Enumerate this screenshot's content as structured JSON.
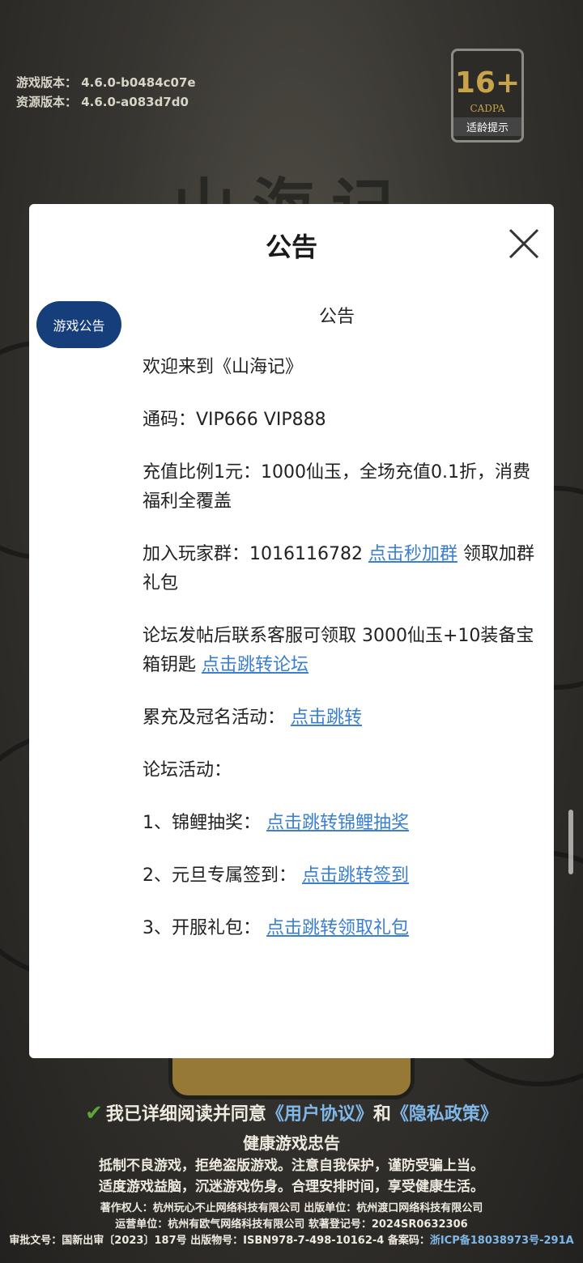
{
  "version": {
    "game": "游戏版本：  4.6.0-b0484c07e",
    "resource": "资源版本：  4.6.0-a083d7d0"
  },
  "age_badge": {
    "rating": "16+",
    "org": "CADPA",
    "tip": "适龄提示"
  },
  "game_title": "山海记",
  "modal": {
    "title": "公告",
    "close_icon": "close-icon",
    "tab_label": "游戏公告",
    "heading": "公告",
    "welcome": "欢迎来到《山海记》",
    "code": "通码：VIP666 VIP888",
    "ratio": "充值比例1元：1000仙玉，全场充值0.1折，消费福利全覆盖",
    "group_prefix": "加入玩家群：1016116782 ",
    "group_link": "点击秒加群",
    "group_suffix": " 领取加群礼包",
    "forum_prefix": "论坛发帖后联系客服可领取 3000仙玉+10装备宝箱钥匙 ",
    "forum_link": "点击跳转论坛",
    "activity_prefix": "累充及冠名活动：  ",
    "activity_link": "点击跳转",
    "forum_activities": "论坛活动：",
    "item1_prefix": "1、锦鲤抽奖：  ",
    "item1_link": "点击跳转锦鲤抽奖",
    "item2_prefix": "2、元旦专属签到：  ",
    "item2_link": "点击跳转签到",
    "item3_prefix": "3、开服礼包：  ",
    "item3_link": "点击跳转领取礼包"
  },
  "footer": {
    "agree_prefix": "我已详细阅读并同意",
    "user_agreement": "《用户协议》",
    "and": "和",
    "privacy": "《隐私政策》",
    "healthy_title": "健康游戏忠告",
    "healthy_line1": "抵制不良游戏，拒绝盗版游戏。注意自我保护，谨防受骗上当。",
    "healthy_line2": "适度游戏益脑，沉迷游戏伤身。合理安排时间，享受健康生活。",
    "copyright": "著作权人：杭州玩心不止网络科技有限公司  出版单位：杭州渡口网络科技有限公司",
    "operator": "运营单位：杭州有欧气网络科技有限公司  软著登记号：2024SR0632306",
    "approval": "审批文号：国新出审〔2023〕187号 出版物号：ISBN978-7-498-10162-4 备案码：",
    "icp": "浙ICP备18038973号-291A"
  },
  "colors": {
    "tab_bg": "#163e7a",
    "link": "#3a7fd0"
  }
}
